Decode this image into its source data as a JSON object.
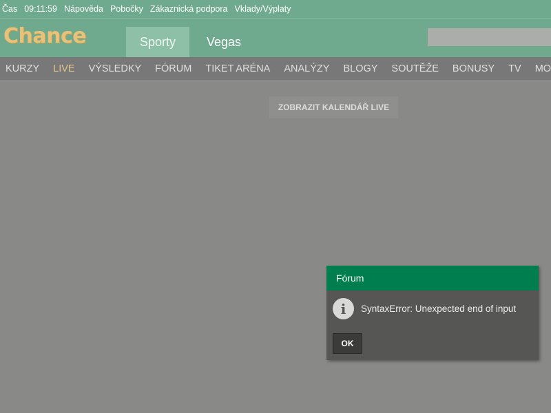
{
  "topbar": {
    "time_label": "Čas",
    "time_value": "09:11:59",
    "links": [
      "Nápověda",
      "Pobočky",
      "Zákaznická podpora",
      "Vklady/Výplaty"
    ]
  },
  "header": {
    "logo": "Chance",
    "tabs": [
      {
        "label": "Sporty",
        "active": true
      },
      {
        "label": "Vegas",
        "active": false
      }
    ],
    "search_value": ""
  },
  "nav": {
    "items": [
      {
        "label": "KURZY",
        "active": false
      },
      {
        "label": "LIVE",
        "active": true
      },
      {
        "label": "VÝSLEDKY",
        "active": false
      },
      {
        "label": "FÓRUM",
        "active": false
      },
      {
        "label": "TIKET ARÉNA",
        "active": false
      },
      {
        "label": "ANALÝZY",
        "active": false
      },
      {
        "label": "BLOGY",
        "active": false
      },
      {
        "label": "SOUTĚŽE",
        "active": false
      },
      {
        "label": "BONUSY",
        "active": false
      },
      {
        "label": "TV",
        "active": false
      },
      {
        "label": "MOBILE",
        "active": false
      }
    ]
  },
  "main": {
    "calendar_button": "ZOBRAZIT KALENDÁŘ LIVE"
  },
  "dialog": {
    "title": "Fórum",
    "icon": "info-icon",
    "icon_glyph": "i",
    "message": "SyntaxError: Unexpected end of input",
    "ok_label": "OK"
  },
  "colors": {
    "header_bg": "#6faa8e",
    "active_tab_bg": "#8ec0a7",
    "logo": "#e8c27a",
    "nav_bg": "#777877",
    "nav_active": "#e0c48c",
    "page_bg": "#898a87",
    "dialog_head": "#007e4f",
    "dialog_bg": "#565655"
  }
}
